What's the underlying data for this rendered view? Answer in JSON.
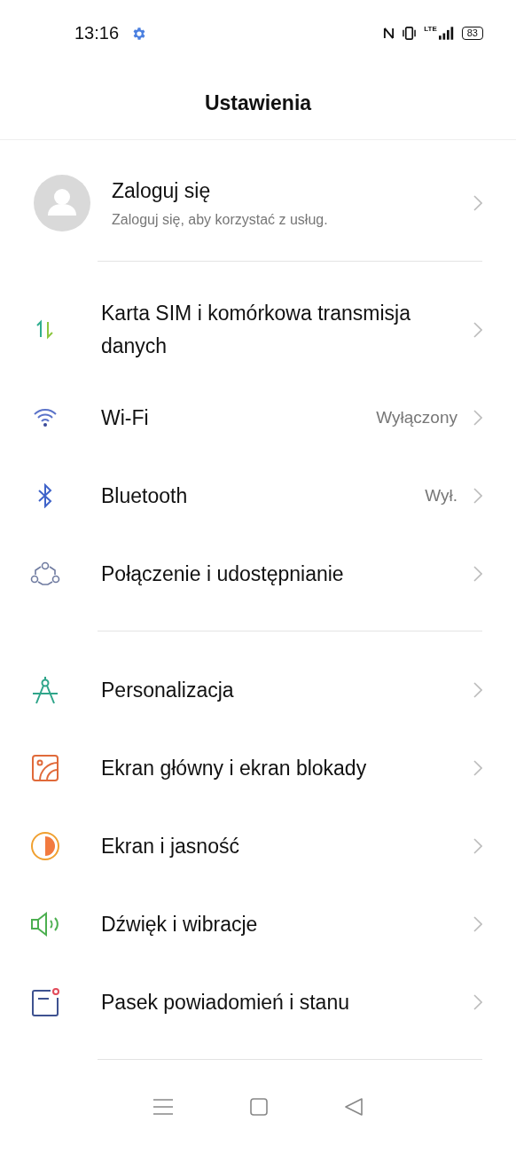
{
  "status_bar": {
    "time": "13:16",
    "network_type": "LTE",
    "battery": "83"
  },
  "title": "Ustawienia",
  "account": {
    "name": "Zaloguj się",
    "subtitle": "Zaloguj się, aby korzystać z usług."
  },
  "groups": [
    {
      "items": [
        {
          "label": "Karta SIM i komórkowa transmisja danych"
        },
        {
          "label": "Wi-Fi",
          "value": "Wyłączony"
        },
        {
          "label": "Bluetooth",
          "value": "Wył."
        },
        {
          "label": "Połączenie i udostępnianie"
        }
      ]
    },
    {
      "items": [
        {
          "label": "Personalizacja"
        },
        {
          "label": "Ekran główny i ekran blokady"
        },
        {
          "label": "Ekran i jasność"
        },
        {
          "label": "Dźwięk i wibracje"
        },
        {
          "label": "Pasek powiadomień i stanu"
        }
      ]
    }
  ]
}
